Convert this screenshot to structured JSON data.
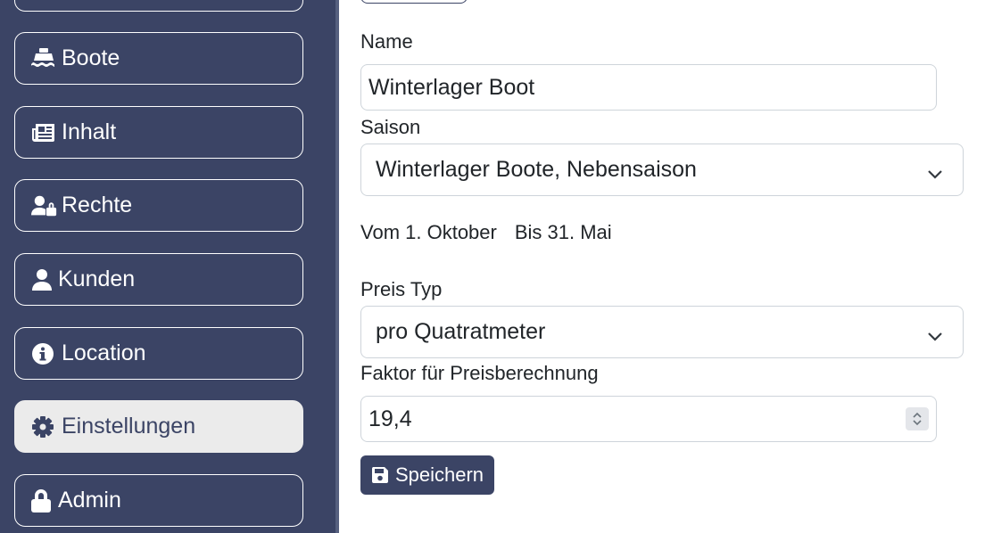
{
  "sidebar": {
    "items": [
      {
        "label": "Boote",
        "icon": "ship-icon"
      },
      {
        "label": "Inhalt",
        "icon": "newspaper-icon"
      },
      {
        "label": "Rechte",
        "icon": "user-lock-icon"
      },
      {
        "label": "Kunden",
        "icon": "user-icon"
      },
      {
        "label": "Location",
        "icon": "info-circle-icon"
      },
      {
        "label": "Einstellungen",
        "icon": "gear-icon",
        "active": true
      },
      {
        "label": "Admin",
        "icon": "lock-icon"
      }
    ]
  },
  "form": {
    "name_label": "Name",
    "name_value": "Winterlager Boot",
    "season_label": "Saison",
    "season_value": "Winterlager Boote, Nebensaison",
    "from_text": "Vom 1. Oktober",
    "to_text": "Bis 31. Mai",
    "price_type_label": "Preis Typ",
    "price_type_value": "pro Quatratmeter",
    "factor_label": "Faktor für Preisberechnung",
    "factor_value": "19,4",
    "save_label": "Speichern"
  },
  "colors": {
    "sidebar_bg": "#3b4465",
    "active_item_bg": "#ebebeb",
    "button_bg": "#3b4465"
  }
}
